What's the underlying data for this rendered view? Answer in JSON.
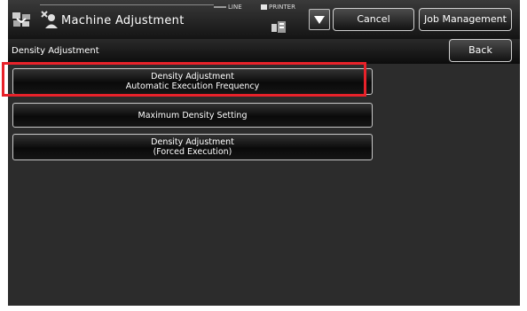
{
  "header": {
    "title": "Machine Adjustment",
    "line_label": "LINE",
    "printer_label": "PRINTER",
    "cancel_label": "Cancel",
    "job_management_label": "Job Management"
  },
  "subheader": {
    "title": "Density Adjustment",
    "back_label": "Back"
  },
  "menu": {
    "items": [
      {
        "lines": [
          "Density Adjustment",
          "Automatic Execution Frequency"
        ],
        "highlighted": true
      },
      {
        "lines": [
          "Maximum Density Setting"
        ],
        "highlighted": false
      },
      {
        "lines": [
          "Density Adjustment",
          "(Forced Execution)"
        ],
        "highlighted": false
      }
    ]
  },
  "colors": {
    "highlight": "#e8222a",
    "screen_background": "#2b2b2b"
  }
}
